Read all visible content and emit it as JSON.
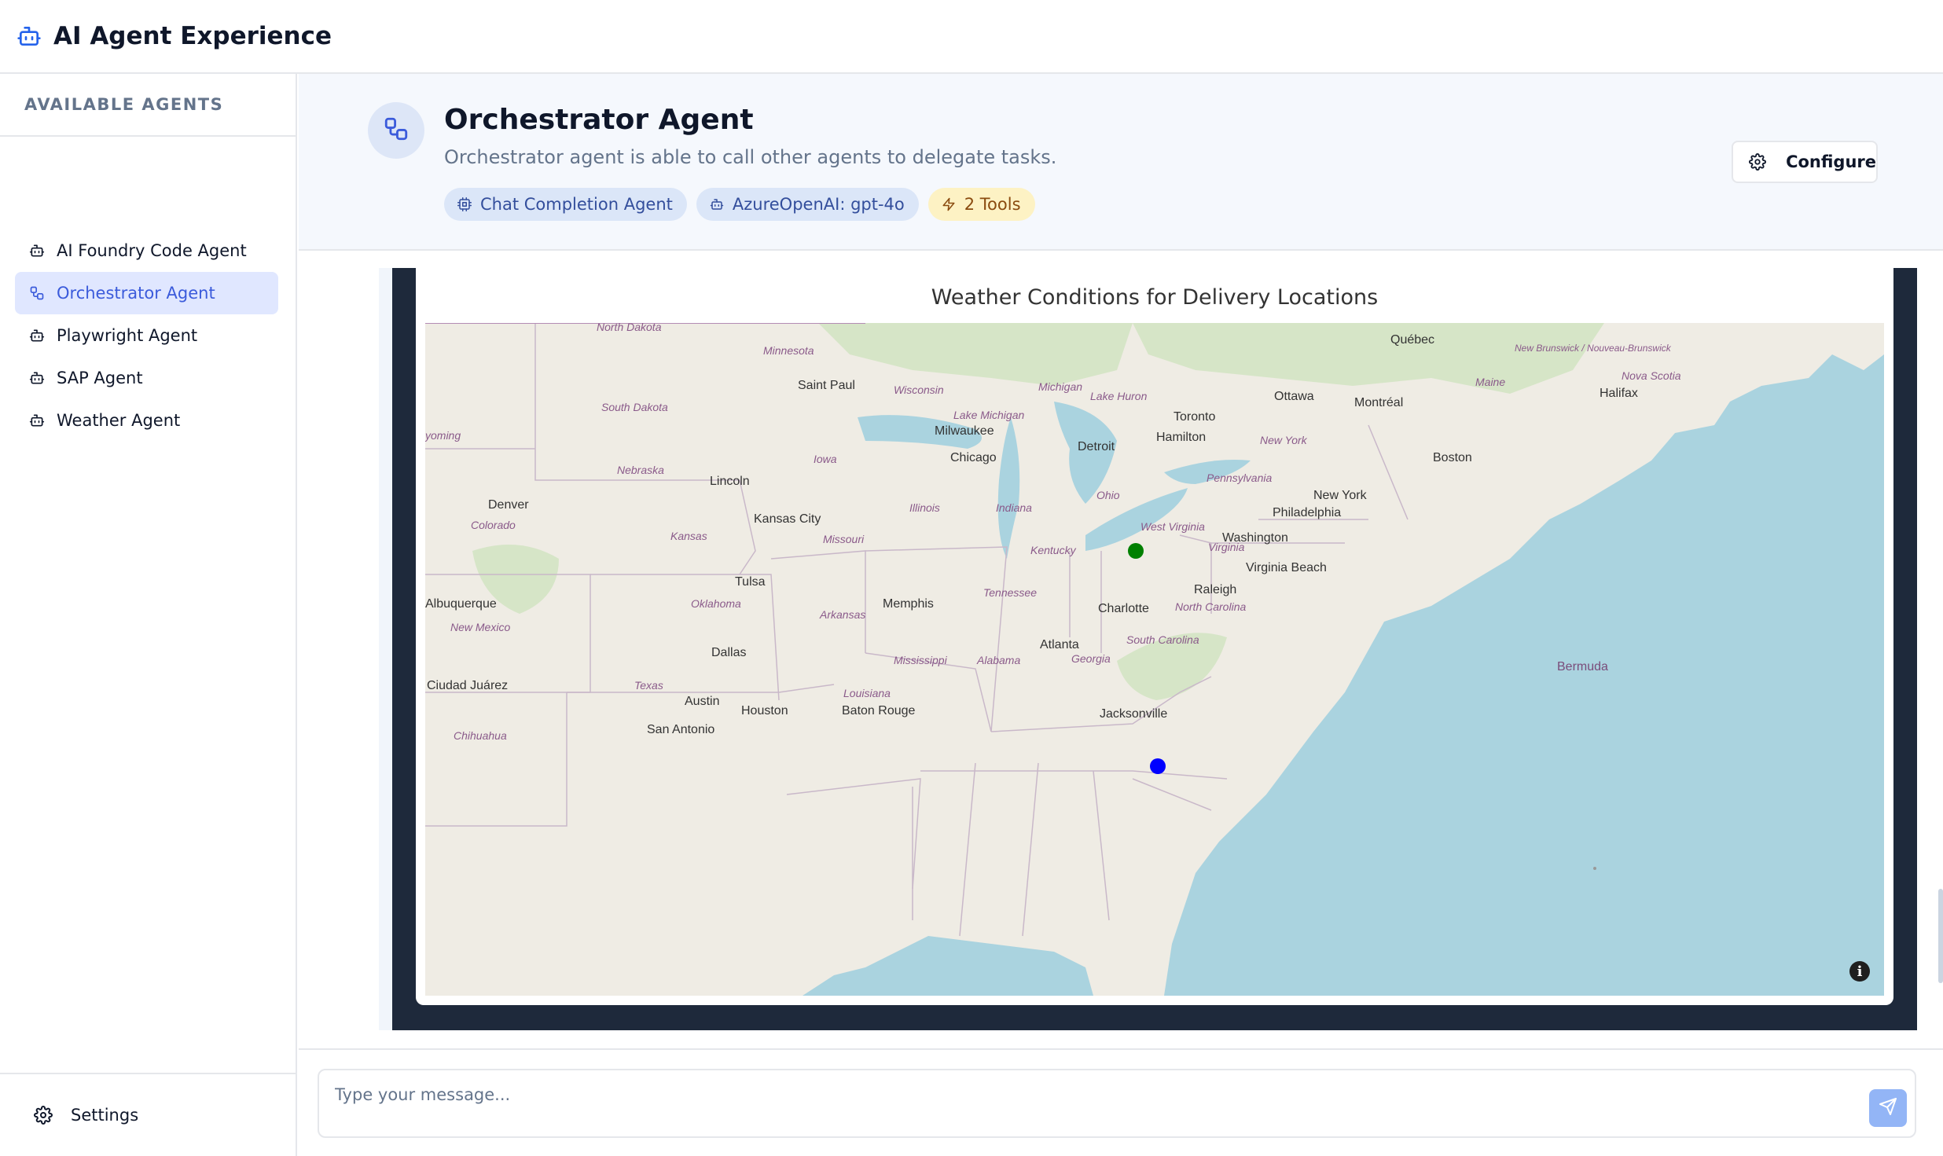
{
  "app": {
    "title": "AI Agent Experience"
  },
  "sidebar": {
    "section_label": "AVAILABLE AGENTS",
    "items": [
      {
        "label": "AI Foundry Code Agent",
        "icon": "bot-icon",
        "active": false
      },
      {
        "label": "Orchestrator Agent",
        "icon": "workflow-icon",
        "active": true
      },
      {
        "label": "Playwright Agent",
        "icon": "bot-icon",
        "active": false
      },
      {
        "label": "SAP Agent",
        "icon": "bot-icon",
        "active": false
      },
      {
        "label": "Weather Agent",
        "icon": "bot-icon",
        "active": false
      }
    ],
    "footer": {
      "label": "Settings",
      "icon": "gear-icon"
    }
  },
  "agent": {
    "name": "Orchestrator Agent",
    "description": "Orchestrator agent is able to call other agents to delegate tasks.",
    "badges": [
      {
        "label": "Chat Completion Agent",
        "icon": "cpu-icon",
        "color": "#dbe6f8"
      },
      {
        "label": "AzureOpenAI: gpt-4o",
        "icon": "bot-icon",
        "color": "#dbe6f8"
      },
      {
        "label": "2 Tools",
        "icon": "lightning-icon",
        "color": "#fdf2c4"
      }
    ],
    "configure_label": "Configure"
  },
  "map": {
    "title": "Weather Conditions for Delivery Locations",
    "markers": [
      {
        "near": "Cleveland, Ohio",
        "color": "#008000"
      },
      {
        "near": "Charlotte, North Carolina",
        "color": "#0000ff"
      }
    ],
    "cities": [
      "Québec",
      "Ottawa",
      "Montréal",
      "Halifax",
      "Toronto",
      "Hamilton",
      "Saint Paul",
      "Milwaukee",
      "Detroit",
      "Chicago",
      "Boston",
      "New York",
      "Philadelphia",
      "Washington",
      "Lincoln",
      "Denver",
      "Kansas City",
      "Virginia Beach",
      "Raleigh",
      "Tulsa",
      "Memphis",
      "Charlotte",
      "Albuquerque",
      "Atlanta",
      "Dallas",
      "Ciudad Juárez",
      "Austin",
      "Houston",
      "Baton Rouge",
      "San Antonio",
      "Jacksonville",
      "Bermuda"
    ],
    "regions": [
      "North Dakota",
      "Minnesota",
      "South Dakota",
      "Wisconsin",
      "Michigan",
      "Lake Huron",
      "Lake Michigan",
      "yoming",
      "Iowa",
      "Nebraska",
      "Illinois",
      "Indiana",
      "Ohio",
      "Pennsylvania",
      "New York",
      "Colorado",
      "Kansas",
      "Missouri",
      "West Virginia",
      "Virginia",
      "Kentucky",
      "Tennessee",
      "Oklahoma",
      "Arkansas",
      "North Carolina",
      "New Mexico",
      "South Carolina",
      "Mississippi",
      "Alabama",
      "Georgia",
      "Texas",
      "Louisiana",
      "Chihuahua",
      "Maine",
      "New Brunswick / Nouveau-Brunswick",
      "Nova Scotia"
    ]
  },
  "composer": {
    "placeholder": "Type your message..."
  }
}
